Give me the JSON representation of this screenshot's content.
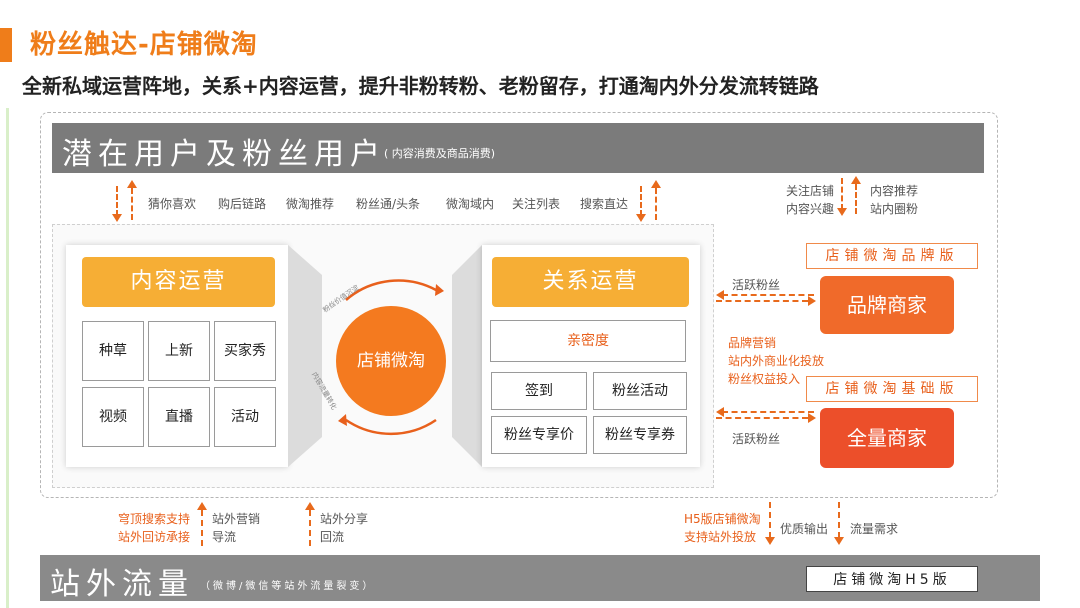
{
  "header": {
    "title": "粉丝触达-店铺微淘",
    "subtitle": "全新私域运营阵地，关系+内容运营，提升非粉转粉、老粉留存，打通淘内外分发流转链路"
  },
  "top_band": {
    "title": "潜在用户及粉丝用户",
    "note": "( 内容消费及商品消费)"
  },
  "channels": [
    "猜你喜欢",
    "购后链路",
    "微淘推荐",
    "粉丝通/头条",
    "微淘域内",
    "关注列表",
    "搜索直达"
  ],
  "top_right": {
    "left_lines": [
      "关注店铺",
      "内容兴趣"
    ],
    "right_lines": [
      "内容推荐",
      "站内圈粉"
    ]
  },
  "content_ops": {
    "title": "内容运营",
    "cells": [
      "种草",
      "上新",
      "买家秀",
      "视频",
      "直播",
      "活动"
    ]
  },
  "center": {
    "label": "店铺微淘",
    "arc_top": "粉丝价值沉淀",
    "arc_left": "内容流量转化"
  },
  "relation_ops": {
    "title": "关系运营",
    "wide_cell": "亲密度",
    "cells": [
      "签到",
      "粉丝活动",
      "粉丝专享价",
      "粉丝专享券"
    ]
  },
  "right": {
    "brand_version": "店铺微淘品牌版",
    "basic_version": "店铺微淘基础版",
    "active_fans": "活跃粉丝",
    "brand_merchant": "品牌商家",
    "all_merchant": "全量商家",
    "brand_lines": [
      "品牌营销",
      "站内外商业化投放",
      "粉丝权益投入"
    ]
  },
  "bottom_notes": {
    "left_orange": [
      "穹顶搜索支持",
      "站外回访承接"
    ],
    "left_gray": [
      "站外营销",
      "导流"
    ],
    "mid_gray": [
      "站外分享",
      "回流"
    ],
    "right_orange": [
      "H5版店铺微淘",
      "支持站外投放"
    ],
    "right_gray1": "优质输出",
    "right_gray2": "流量需求"
  },
  "bottom_band": {
    "title": "站外流量",
    "note": "（微博/微信等站外流量裂变）",
    "h5": "店铺微淘H5版"
  },
  "colors": {
    "accent": "#ef7d1a",
    "pill": "#f6ae35",
    "merchant": "#f06a2a",
    "band": "#7b7b7b"
  }
}
